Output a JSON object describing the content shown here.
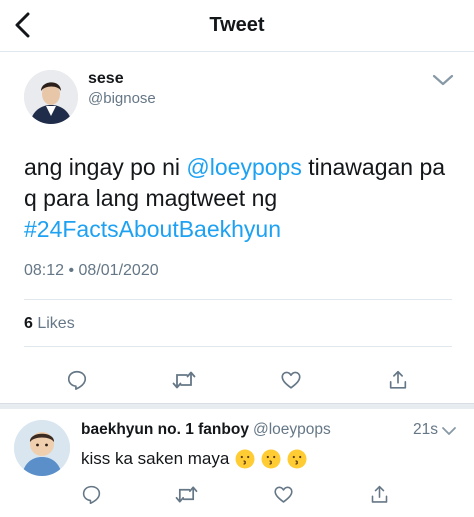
{
  "header": {
    "title": "Tweet"
  },
  "tweet": {
    "author_name": "sese",
    "author_handle": "@bignose",
    "text_part1": "ang ingay po ni ",
    "mention": "@loeypops",
    "text_part2": " tinawagan pa q para lang magtweet ng ",
    "hashtag": "#24FactsAboutBaekhyun",
    "timestamp": "08:12 • 08/01/2020",
    "likes_count": "6",
    "likes_label": " Likes"
  },
  "reply": {
    "author_name": "baekhyun no. 1 fanboy",
    "author_handle": "@loeypops",
    "time": "21s",
    "text": "kiss ka saken maya"
  },
  "colors": {
    "link": "#1da1f2",
    "secondary_text": "#657786",
    "icon": "#657786",
    "divider": "#e1e8ed"
  },
  "icons": [
    "back-arrow-icon",
    "chevron-down-icon",
    "reply-icon",
    "retweet-icon",
    "like-icon",
    "share-icon",
    "kissing-emoji-icon"
  ]
}
